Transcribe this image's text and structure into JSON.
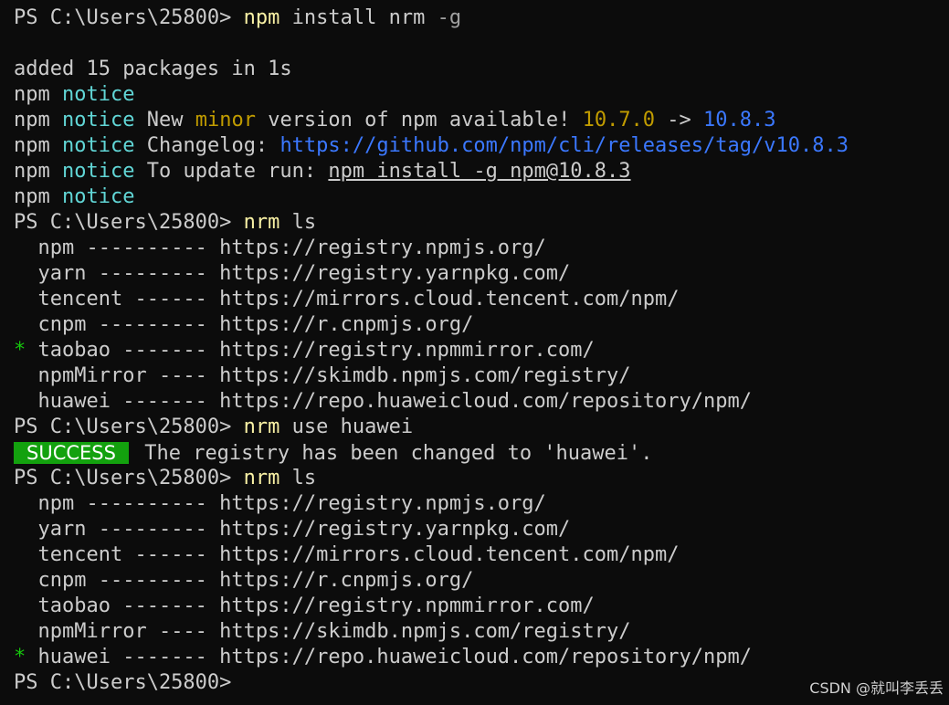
{
  "terminal": {
    "prompt": "PS C:\\Users\\25800>",
    "install_cmd_name": "npm",
    "install_cmd_args": " install nrm",
    "install_cmd_flag": " -g",
    "added_msg": "added 15 packages in 1s",
    "npm_label": "npm",
    "notice_label": "notice",
    "new_text": " New ",
    "minor_text": "minor",
    "version_text": " version of npm available! ",
    "old_version": "10.7.0",
    "arrow": " -> ",
    "new_version": "10.8.3",
    "changelog_label": " Changelog: ",
    "changelog_url": "https://github.com/npm/cli/releases/tag/v10.8.3",
    "update_label": " To update run: ",
    "update_cmd": "npm install -g npm@10.8.3",
    "nrm_cmd": "nrm",
    "ls_args": " ls",
    "use_args": " use huawei",
    "success_badge": "SUCCESS",
    "success_msg": " The registry has been changed to 'huawei'.",
    "star": "*",
    "registries_first": [
      {
        "marker": " ",
        "line": " npm ---------- https://registry.npmjs.org/"
      },
      {
        "marker": " ",
        "line": " yarn --------- https://registry.yarnpkg.com/"
      },
      {
        "marker": " ",
        "line": " tencent ------ https://mirrors.cloud.tencent.com/npm/"
      },
      {
        "marker": " ",
        "line": " cnpm --------- https://r.cnpmjs.org/"
      },
      {
        "marker": "*",
        "line": " taobao ------- https://registry.npmmirror.com/"
      },
      {
        "marker": " ",
        "line": " npmMirror ---- https://skimdb.npmjs.com/registry/"
      },
      {
        "marker": " ",
        "line": " huawei ------- https://repo.huaweicloud.com/repository/npm/"
      }
    ],
    "registries_second": [
      {
        "marker": " ",
        "line": " npm ---------- https://registry.npmjs.org/"
      },
      {
        "marker": " ",
        "line": " yarn --------- https://registry.yarnpkg.com/"
      },
      {
        "marker": " ",
        "line": " tencent ------ https://mirrors.cloud.tencent.com/npm/"
      },
      {
        "marker": " ",
        "line": " cnpm --------- https://r.cnpmjs.org/"
      },
      {
        "marker": " ",
        "line": " taobao ------- https://registry.npmmirror.com/"
      },
      {
        "marker": " ",
        "line": " npmMirror ---- https://skimdb.npmjs.com/registry/"
      },
      {
        "marker": "*",
        "line": " huawei ------- https://repo.huaweicloud.com/repository/npm/"
      }
    ]
  },
  "watermark": "CSDN @就叫李丢丢",
  "colors": {
    "background": "#0c0c0c",
    "text": "#cccccc",
    "command": "#f9f1a5",
    "notice": "#61d6d6",
    "minor": "#c19c00",
    "link": "#3b78ff",
    "success_bg": "#13a10e",
    "star": "#16c60c"
  }
}
